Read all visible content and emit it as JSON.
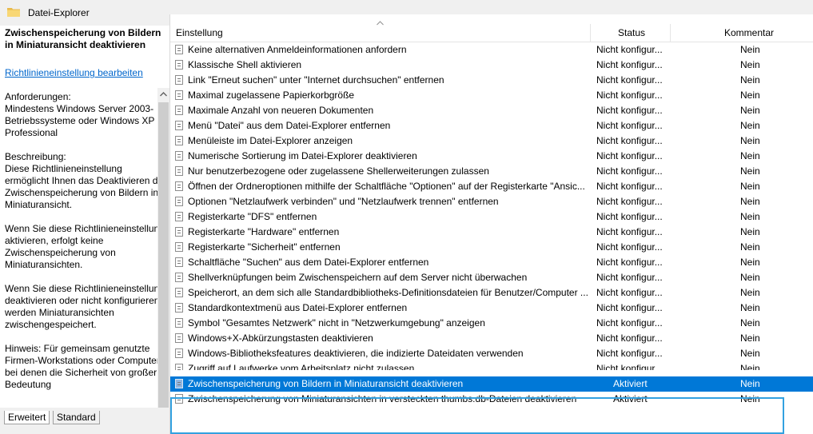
{
  "window": {
    "title": "Datei-Explorer",
    "icon": "folder-icon"
  },
  "description": {
    "title": "Zwischenspeicherung von Bildern in Miniaturansicht deaktivieren",
    "edit_link": "Richtlinieneinstellung bearbeiten",
    "requirements": "Anforderungen:\nMindestens Windows Server 2003-Betriebssysteme oder Windows XP Professional",
    "description": "Beschreibung:\nDiese Richtlinieneinstellung ermöglicht Ihnen das Deaktivieren der Zwischenspeicherung von Bildern in Miniaturansicht.",
    "if_enabled": "Wenn Sie diese Richtlinieneinstellung aktivieren, erfolgt keine Zwischenspeicherung von Miniaturansichten.",
    "if_disabled": "Wenn Sie diese Richtlinieneinstellung deaktivieren oder nicht konfigurieren, werden Miniaturansichten zwischengespeichert.",
    "hint": "Hinweis: Für gemeinsam genutzte Firmen-Workstations oder Computer, bei denen die Sicherheit von großer Bedeutung"
  },
  "tabs": [
    {
      "label": "Erweitert"
    },
    {
      "label": "Standard"
    }
  ],
  "columns": {
    "setting": "Einstellung",
    "status": "Status",
    "comment": "Kommentar"
  },
  "rows": [
    {
      "name": "Keine alternativen Anmeldeinformationen anfordern",
      "status": "Nicht konfigur...",
      "comment": "Nein"
    },
    {
      "name": "Klassische Shell aktivieren",
      "status": "Nicht konfigur...",
      "comment": "Nein"
    },
    {
      "name": "Link \"Erneut suchen\" unter \"Internet durchsuchen\" entfernen",
      "status": "Nicht konfigur...",
      "comment": "Nein"
    },
    {
      "name": "Maximal zugelassene Papierkorbgröße",
      "status": "Nicht konfigur...",
      "comment": "Nein"
    },
    {
      "name": "Maximale Anzahl von neueren Dokumenten",
      "status": "Nicht konfigur...",
      "comment": "Nein"
    },
    {
      "name": "Menü \"Datei\" aus dem Datei-Explorer entfernen",
      "status": "Nicht konfigur...",
      "comment": "Nein"
    },
    {
      "name": "Menüleiste im Datei-Explorer anzeigen",
      "status": "Nicht konfigur...",
      "comment": "Nein"
    },
    {
      "name": "Numerische Sortierung im Datei-Explorer deaktivieren",
      "status": "Nicht konfigur...",
      "comment": "Nein"
    },
    {
      "name": "Nur benutzerbezogene oder zugelassene Shellerweiterungen zulassen",
      "status": "Nicht konfigur...",
      "comment": "Nein"
    },
    {
      "name": "Öffnen der Ordneroptionen mithilfe der Schaltfläche \"Optionen\" auf der Registerkarte \"Ansic...",
      "status": "Nicht konfigur...",
      "comment": "Nein"
    },
    {
      "name": "Optionen \"Netzlaufwerk verbinden\" und \"Netzlaufwerk trennen\" entfernen",
      "status": "Nicht konfigur...",
      "comment": "Nein"
    },
    {
      "name": "Registerkarte \"DFS\" entfernen",
      "status": "Nicht konfigur...",
      "comment": "Nein"
    },
    {
      "name": "Registerkarte \"Hardware\" entfernen",
      "status": "Nicht konfigur...",
      "comment": "Nein"
    },
    {
      "name": "Registerkarte \"Sicherheit\" entfernen",
      "status": "Nicht konfigur...",
      "comment": "Nein"
    },
    {
      "name": "Schaltfläche \"Suchen\" aus dem Datei-Explorer entfernen",
      "status": "Nicht konfigur...",
      "comment": "Nein"
    },
    {
      "name": "Shellverknüpfungen beim Zwischenspeichern auf dem Server nicht überwachen",
      "status": "Nicht konfigur...",
      "comment": "Nein"
    },
    {
      "name": "Speicherort, an dem sich alle Standardbibliotheks-Definitionsdateien für Benutzer/Computer ...",
      "status": "Nicht konfigur...",
      "comment": "Nein"
    },
    {
      "name": "Standardkontextmenü aus Datei-Explorer entfernen",
      "status": "Nicht konfigur...",
      "comment": "Nein"
    },
    {
      "name": "Symbol \"Gesamtes Netzwerk\" nicht in \"Netzwerkumgebung\" anzeigen",
      "status": "Nicht konfigur...",
      "comment": "Nein"
    },
    {
      "name": "Windows+X-Abkürzungstasten deaktivieren",
      "status": "Nicht konfigur...",
      "comment": "Nein"
    },
    {
      "name": "Windows-Bibliotheksfeatures deaktivieren, die indizierte Dateidaten verwenden",
      "status": "Nicht konfigur...",
      "comment": "Nein"
    },
    {
      "name": "Zugriff auf Laufwerke vom Arbeitsplatz nicht zulassen",
      "status": "Nicht konfigur...",
      "comment": "Nein"
    },
    {
      "name": "Zwischenspeicherung von Bildern in Miniaturansicht deaktivieren",
      "status": "Aktiviert",
      "comment": "Nein"
    },
    {
      "name": "Zwischenspeicherung von Miniaturansichten in versteckten thumbs.db-Dateien deaktivieren",
      "status": "Aktiviert",
      "comment": "Nein"
    }
  ],
  "colors": {
    "selection": "#0078d7",
    "highlight_frame": "#33a1e0",
    "link": "#0066cc"
  }
}
